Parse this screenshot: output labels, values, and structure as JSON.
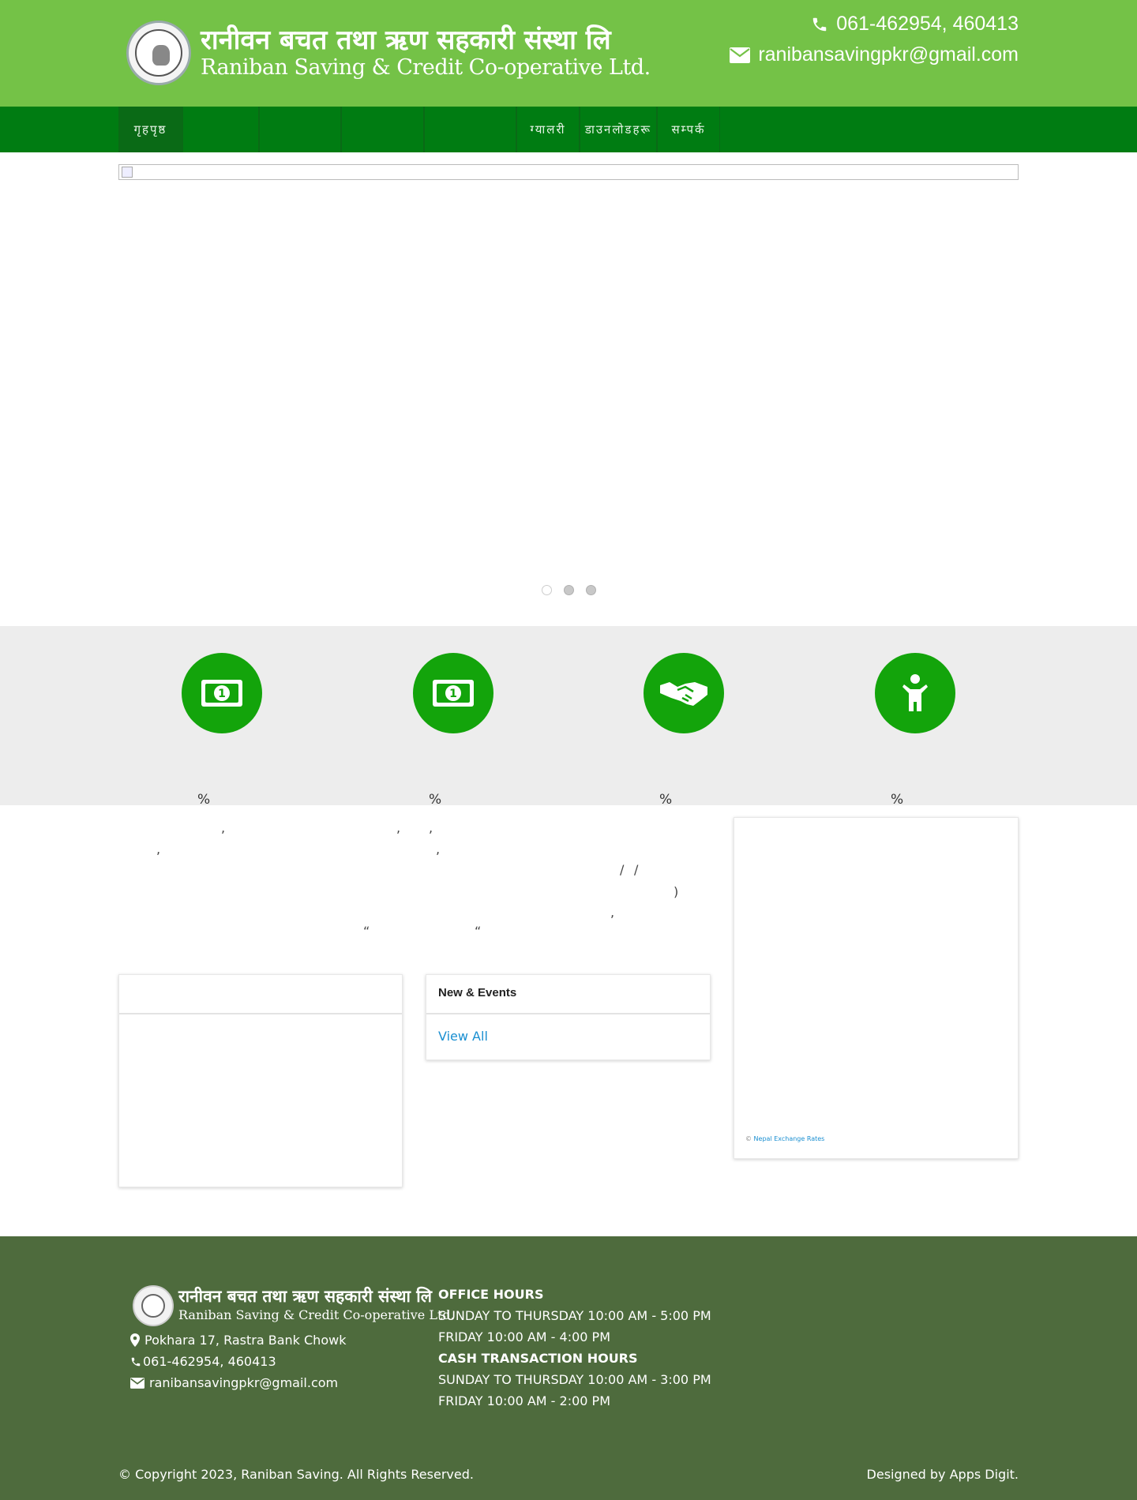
{
  "header": {
    "org_name_np": "रानीवन बचत तथा ऋण सहकारी संस्था लि",
    "org_name_en": "Raniban Saving & Credit Co-operative Ltd.",
    "phone": "061-462954, 460413",
    "email": "ranibansavingpkr@gmail.com"
  },
  "nav": {
    "items": [
      {
        "label": "गृहपृष्ठ"
      },
      {
        "label": ""
      },
      {
        "label": ""
      },
      {
        "label": ""
      },
      {
        "label": ""
      },
      {
        "label": "ग्यालरी"
      },
      {
        "label": "डाउनलोडहरू"
      },
      {
        "label": "सम्पर्क"
      }
    ]
  },
  "slider": {
    "dots": 3,
    "active_dot": 1
  },
  "features": [
    {
      "icon": "money-bill-icon",
      "pct": "%"
    },
    {
      "icon": "money-bill-icon",
      "pct": "%"
    },
    {
      "icon": "handshake-icon",
      "pct": "%"
    },
    {
      "icon": "child-icon",
      "pct": "%"
    }
  ],
  "intro": {
    "fragments": [
      ",",
      ",",
      ",",
      ",",
      ",",
      "/",
      "/",
      ")",
      ",",
      "“",
      "“"
    ]
  },
  "panels": {
    "left_title": "",
    "news_title": "New & Events",
    "news_view_all": "View All",
    "rates_credit_prefix": "©",
    "rates_credit_link": "Nepal Exchange Rates"
  },
  "footer": {
    "org_name_np": "रानीवन बचत तथा ऋण सहकारी संस्था लि",
    "org_name_en": "Raniban Saving & Credit Co-operative Ltd.",
    "address": "Pokhara 17, Rastra Bank Chowk",
    "phone": "061-462954, 460413",
    "email": "ranibansavingpkr@gmail.com",
    "office_hours_title": "Office Hours",
    "office_hours_1": "Sunday to Thursday 10:00 AM - 5:00 PM",
    "office_hours_2": "Friday 10:00 AM - 4:00 PM",
    "cash_hours_title": "Cash Transaction Hours",
    "cash_hours_1": "Sunday to Thursday 10:00 AM - 3:00 PM",
    "cash_hours_2": "Friday 10:00 AM - 2:00 PM",
    "copyright": "© Copyright 2023, Raniban Saving. All Rights Reserved.",
    "designed_by": "Designed by Apps Digit."
  },
  "colors": {
    "header_green": "#74c247",
    "nav_green": "#007c12",
    "icon_green": "#13a40b",
    "footer_green": "#4e6b3d",
    "link_blue": "#1a8fd1"
  }
}
